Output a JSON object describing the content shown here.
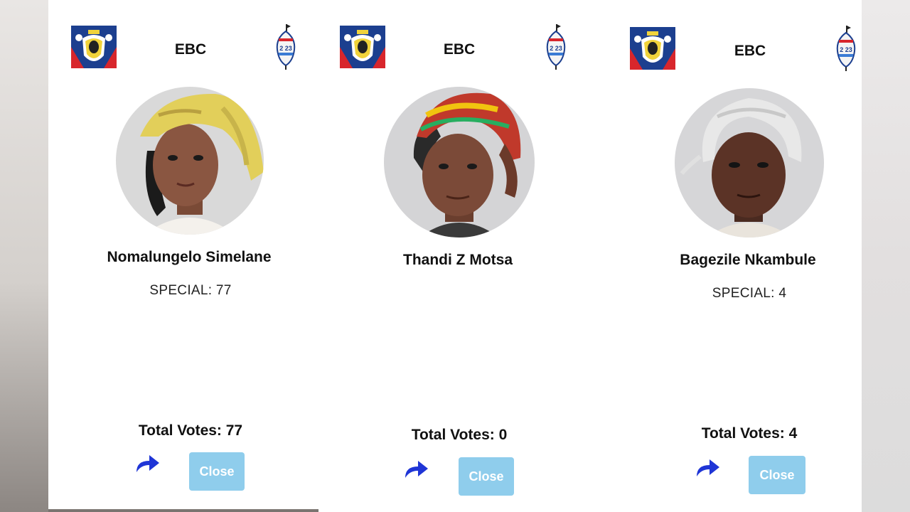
{
  "cards": [
    {
      "brand": "EBC",
      "name": "Nomalungelo Simelane",
      "special": "SPECIAL: 77",
      "total": "Total Votes: 77",
      "close_label": "Close"
    },
    {
      "brand": "EBC",
      "name": "Thandi Z Motsa",
      "special": "",
      "total": "Total Votes: 0",
      "close_label": "Close"
    },
    {
      "brand": "EBC",
      "name": "Bagezile Nkambule",
      "special": "SPECIAL: 4",
      "total": "Total Votes: 4",
      "close_label": "Close"
    }
  ],
  "emblem_text": "2 23",
  "icons": {
    "left_logo": "ebc-shield-logo-icon",
    "right_logo": "election-2023-emblem-icon",
    "share": "share-arrow-icon"
  },
  "colors": {
    "close_button": "#8fcdec",
    "share_icon": "#1f35d6",
    "logo_blue": "#1c3f8f",
    "logo_red": "#d8262c"
  }
}
